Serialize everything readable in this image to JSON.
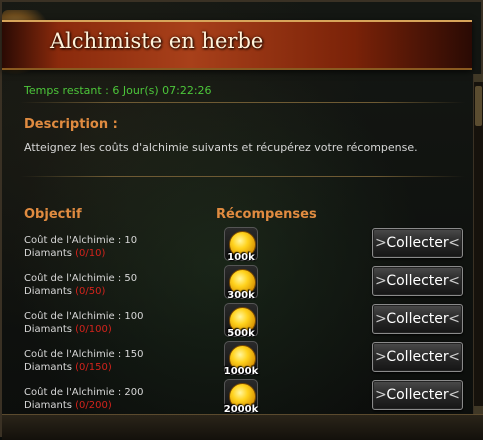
{
  "window": {
    "title": "Alchimiste en herbe"
  },
  "event": {
    "time_left": "Temps restant : 6 Jour(s)  07:22:26"
  },
  "description": {
    "heading": "Description :",
    "text": "Atteignez les coûts d'alchimie suivants et récupérez votre récompense."
  },
  "columns": {
    "objective": "Objectif",
    "rewards": "Récompenses"
  },
  "rows": [
    {
      "label": "Coût de l'Alchimie : 10",
      "currency": "Diamants",
      "progress": "(0/10)",
      "reward": "100k",
      "button": "Collecter"
    },
    {
      "label": "Coût de l'Alchimie : 50",
      "currency": "Diamants",
      "progress": "(0/50)",
      "reward": "300k",
      "button": "Collecter"
    },
    {
      "label": "Coût de l'Alchimie : 100",
      "currency": "Diamants",
      "progress": "(0/100)",
      "reward": "500k",
      "button": "Collecter"
    },
    {
      "label": "Coût de l'Alchimie : 150",
      "currency": "Diamants",
      "progress": "(0/150)",
      "reward": "1000k",
      "button": "Collecter"
    },
    {
      "label": "Coût de l'Alchimie : 200",
      "currency": "Diamants",
      "progress": "(0/200)",
      "reward": "2000k",
      "button": "Collecter"
    }
  ],
  "colors": {
    "accent": "#e08b40",
    "time_green": "#4cc63a",
    "progress_red": "#d2231c"
  }
}
